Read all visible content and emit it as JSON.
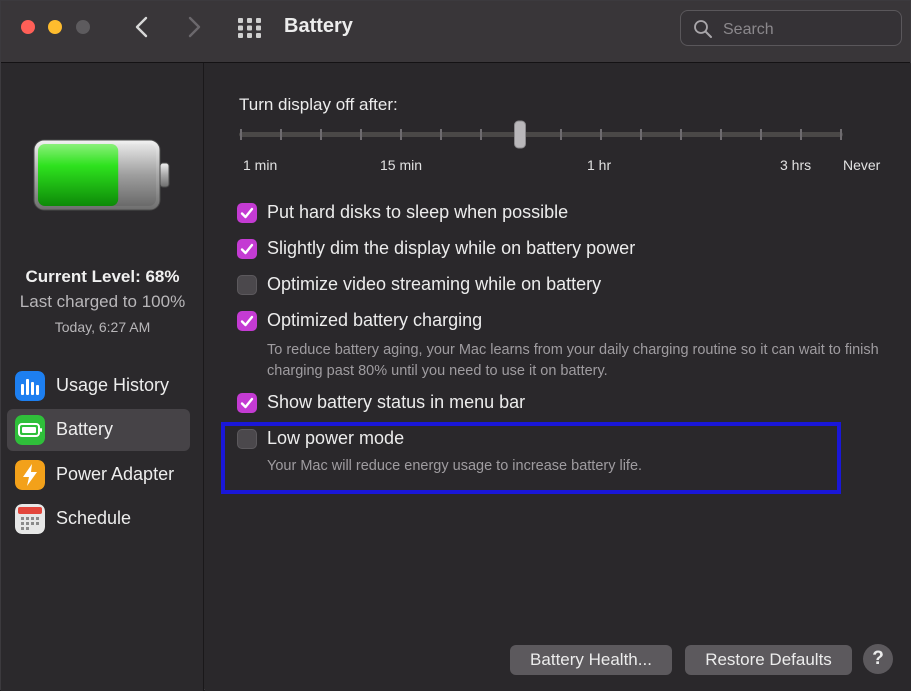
{
  "window": {
    "title": "Battery",
    "search_placeholder": "Search"
  },
  "sidebar": {
    "battery_level_color": "#2ecc1f",
    "current_level": "Current Level: 68%",
    "last_charged": "Last charged to 100%",
    "charged_time": "Today, 6:27 AM",
    "items": [
      {
        "label": "Usage History",
        "icon": "bar-chart-icon",
        "color": "#1d7ff0"
      },
      {
        "label": "Battery",
        "icon": "battery-icon",
        "color": "#2fbf3a"
      },
      {
        "label": "Power Adapter",
        "icon": "lightning-icon",
        "color": "#f3a11a"
      },
      {
        "label": "Schedule",
        "icon": "calendar-icon",
        "color": "#e7e7e7"
      }
    ]
  },
  "display_sleep": {
    "title": "Turn display off after:",
    "labels": [
      "1 min",
      "15 min",
      "1 hr",
      "3 hrs",
      "Never"
    ],
    "value_position": 0.465
  },
  "options": [
    {
      "label": "Put hard disks to sleep when possible",
      "checked": true
    },
    {
      "label": "Slightly dim the display while on battery power",
      "checked": true
    },
    {
      "label": "Optimize video streaming while on battery",
      "checked": false
    },
    {
      "label": "Optimized battery charging",
      "checked": true,
      "description": "To reduce battery aging, your Mac learns from your daily charging routine so it can wait to finish charging past 80% until you need to use it on battery."
    },
    {
      "label": "Show battery status in menu bar",
      "checked": true
    },
    {
      "label": "Low power mode",
      "checked": false,
      "description": "Your Mac will reduce energy usage to increase battery life."
    }
  ],
  "buttons": {
    "battery_health": "Battery Health...",
    "restore_defaults": "Restore Defaults",
    "help": "?"
  },
  "colors": {
    "accent": "#c43bd3",
    "highlight_box": "#1a17d8"
  }
}
